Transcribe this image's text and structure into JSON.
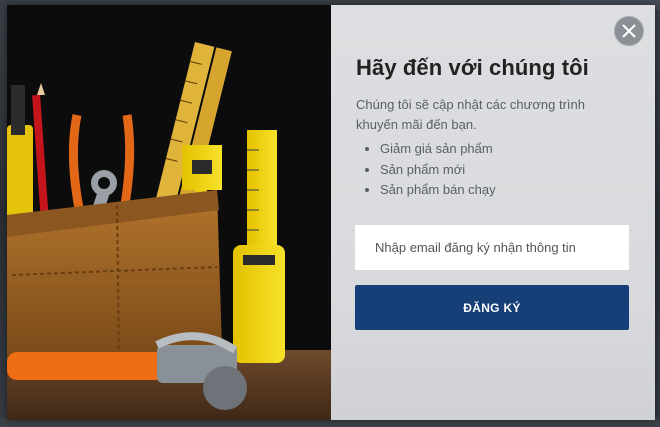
{
  "modal": {
    "title": "Hãy đến với chúng tôi",
    "description": "Chúng tôi sẽ cập nhật các chương trình khuyến mãi đến bạn.",
    "benefits": [
      "Giảm giá sản phẩm",
      "Sản phẩm mới",
      "Sản phẩm bán chạy"
    ],
    "email_placeholder": "Nhập email đăng ký nhận thông tin",
    "submit_label": "ĐĂNG KÝ",
    "close_icon": "close-icon",
    "image_description_icon": "tool-belt-image"
  },
  "colors": {
    "submit_bg": "#173f77",
    "panel_bg": "#d9dbde",
    "close_bg": "#8c9096"
  }
}
